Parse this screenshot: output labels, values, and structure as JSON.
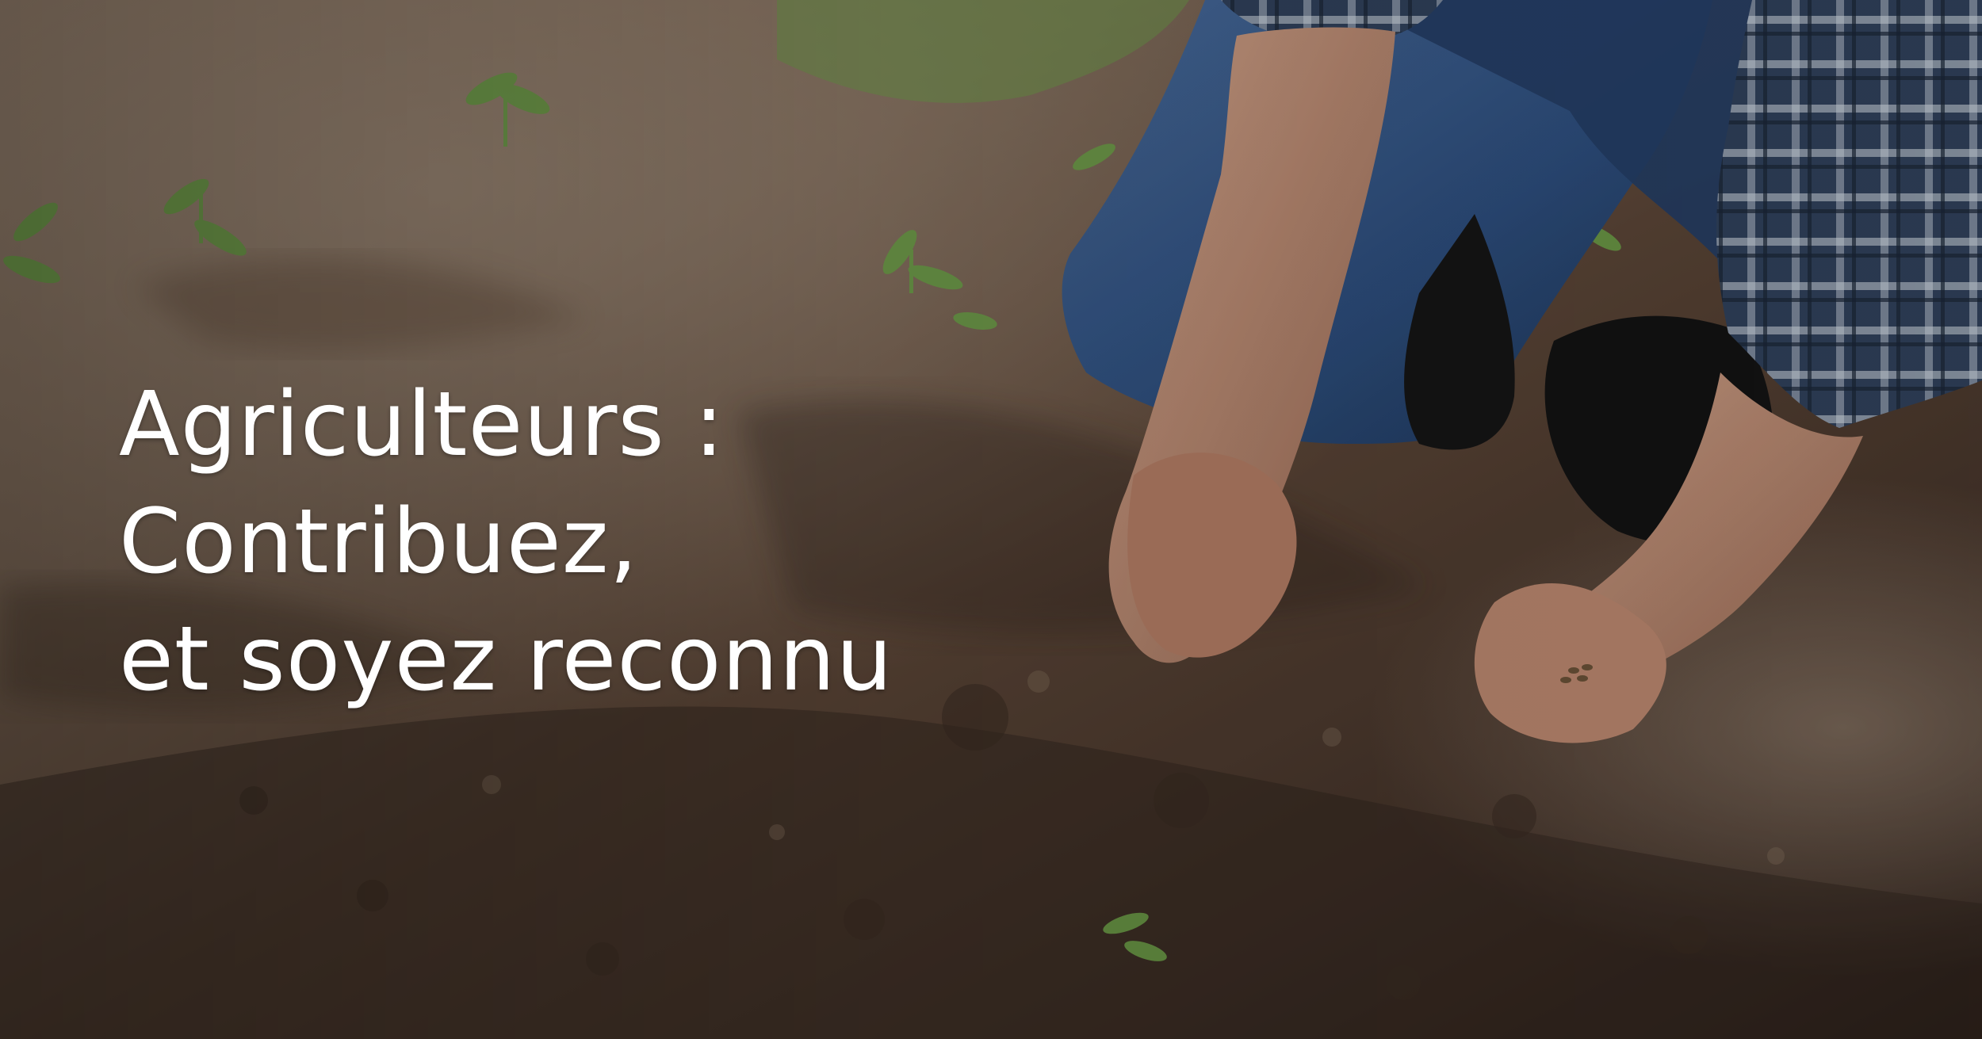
{
  "hero": {
    "headline_lines": [
      "Agriculteurs :",
      "Contribuez,",
      "et soyez reconnu"
    ],
    "photo": {
      "subject": "farmer-hands-planting-seeds-in-soil",
      "colors": {
        "soil_dark": "#3b2a20",
        "soil_light": "#8a7462",
        "denim": "#2d4f7c",
        "plaid_shirt": "#31435e",
        "skin": "#c39179",
        "seedling_green": "#6fa34a"
      }
    },
    "text_color": "#ffffff"
  }
}
